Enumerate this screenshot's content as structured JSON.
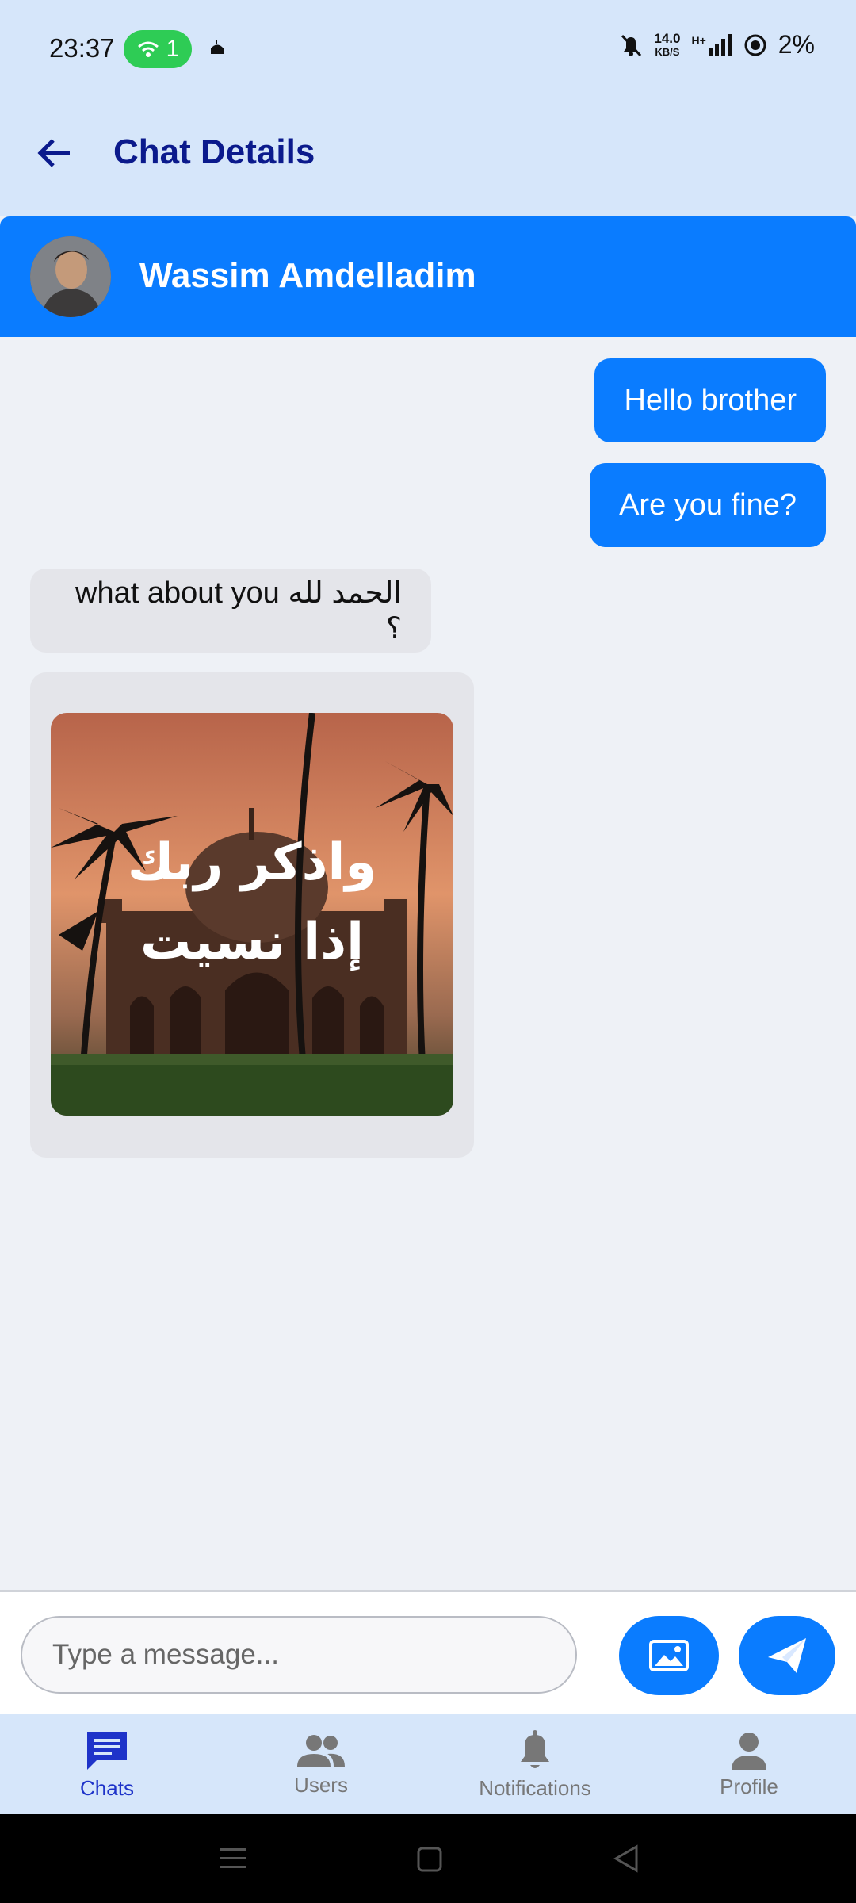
{
  "status_bar": {
    "time": "23:37",
    "hotspot_count": "1",
    "net_speed_value": "14.0",
    "net_speed_unit": "KB/S",
    "network_type": "H+",
    "battery": "2%"
  },
  "app_bar": {
    "title": "Chat Details",
    "back_icon": "arrow-left-icon"
  },
  "contact": {
    "name": "Wassim Amdelladim"
  },
  "messages": [
    {
      "direction": "outgoing",
      "text": "Hello brother"
    },
    {
      "direction": "outgoing",
      "text": "Are you fine?"
    },
    {
      "direction": "incoming",
      "text": "الحمد لله what about you ؟"
    },
    {
      "direction": "incoming",
      "type": "image",
      "image_caption": "واذكر ربك إذا نسيت"
    }
  ],
  "composer": {
    "placeholder": "Type a message...",
    "image_button_icon": "image-icon",
    "send_button_icon": "send-icon"
  },
  "bottom_nav": {
    "items": [
      {
        "label": "Chats",
        "icon": "chat-icon",
        "active": true
      },
      {
        "label": "Users",
        "icon": "users-icon",
        "active": false
      },
      {
        "label": "Notifications",
        "icon": "bell-icon",
        "active": false
      },
      {
        "label": "Profile",
        "icon": "person-icon",
        "active": false
      }
    ]
  },
  "colors": {
    "accent": "#0a7cff",
    "title": "#0b1a8c",
    "nav_active": "#1e33c9",
    "header_bg": "#d6e6fa"
  }
}
